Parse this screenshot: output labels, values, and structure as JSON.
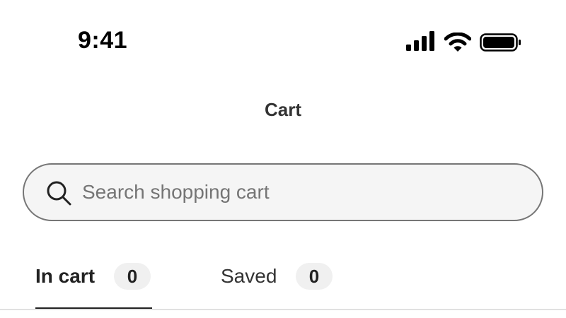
{
  "status_bar": {
    "time": "9:41",
    "icons": [
      "cellular-signal-icon",
      "wifi-icon",
      "battery-icon"
    ]
  },
  "header": {
    "title": "Cart"
  },
  "search": {
    "placeholder": "Search shopping cart",
    "value": "",
    "icon": "search-icon"
  },
  "tabs": [
    {
      "label": "In cart",
      "count": "0",
      "selected": true
    },
    {
      "label": "Saved",
      "count": "0",
      "selected": false
    }
  ],
  "colors": {
    "text_primary": "#222222",
    "search_border": "#767676",
    "search_background": "#f5f5f5",
    "badge_background": "#f0f0f0",
    "divider": "#e1e1e1"
  }
}
